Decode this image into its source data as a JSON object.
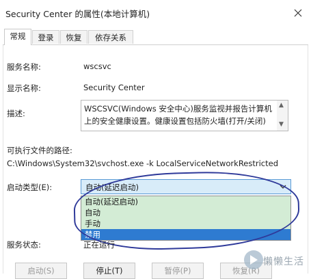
{
  "window": {
    "title": "Security Center 的属性(本地计算机)"
  },
  "tabs": [
    {
      "label": "常规",
      "active": true
    },
    {
      "label": "登录",
      "active": false
    },
    {
      "label": "恢复",
      "active": false
    },
    {
      "label": "依存关系",
      "active": false
    }
  ],
  "general": {
    "service_name_label": "服务名称:",
    "service_name_value": "wscsvc",
    "display_name_label": "显示名称:",
    "display_name_value": "Security Center",
    "description_label": "描述:",
    "description_text": "WSCSVC(Windows 安全中心)服务监视并报告计算机上的安全健康设置。健康设置包括防火墙(打开/关闭)",
    "exe_path_label": "可执行文件的路径:",
    "exe_path_value": "C:\\Windows\\System32\\svchost.exe -k LocalServiceNetworkRestricted",
    "startup_type_label": "启动类型(E):",
    "startup_type_selected": "自动(延迟启动)",
    "startup_options": [
      "自动(延迟启动)",
      "自动",
      "手动",
      "禁用"
    ],
    "highlighted_option": "禁用",
    "service_status_label": "服务状态:",
    "service_status_value": "正在运行"
  },
  "buttons": {
    "start": "启动(S)",
    "stop": "停止(T)",
    "pause": "暂停(P)",
    "resume": "恢复(R)"
  },
  "watermark": {
    "text": "懒懒生活"
  },
  "colors": {
    "combo_bg": "#d8ecf9",
    "option_bg": "#d3ecd5",
    "option_selected_bg": "#2e7bd1",
    "annotation_circle": "#2f3a9a"
  }
}
